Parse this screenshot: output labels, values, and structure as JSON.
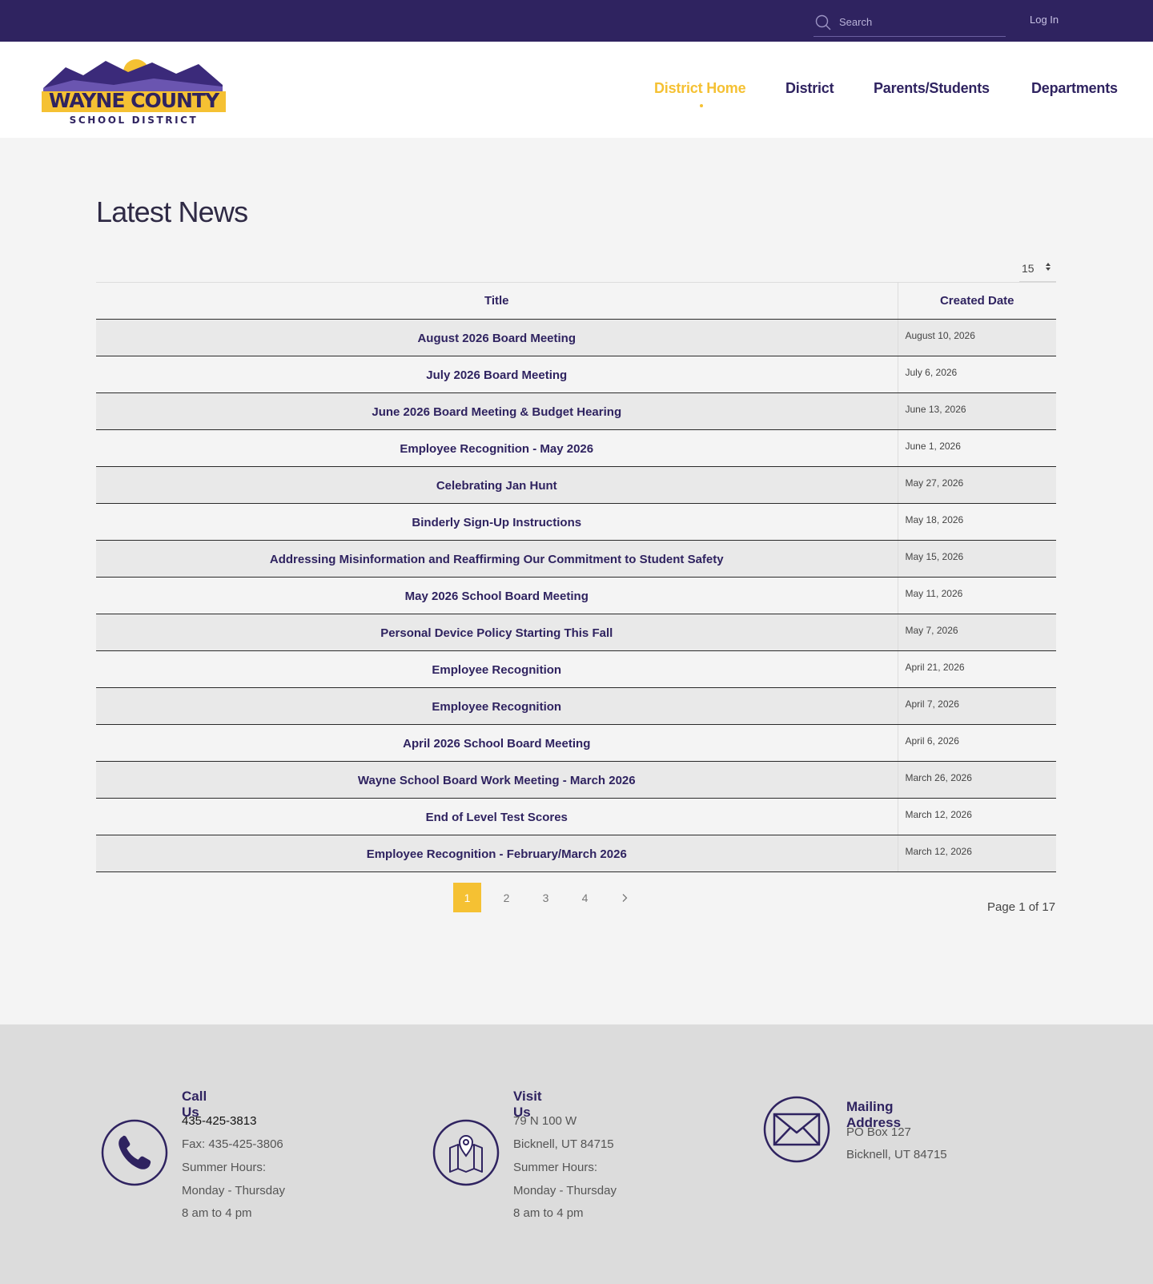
{
  "topbar": {
    "search_placeholder": "Search",
    "login_label": "Log In"
  },
  "logo": {
    "line1": "WAYNE COUNTY",
    "line2": "SCHOOL DISTRICT"
  },
  "nav": {
    "items": [
      {
        "label": "District Home",
        "active": true
      },
      {
        "label": "District",
        "active": false
      },
      {
        "label": "Parents/Students",
        "active": false
      },
      {
        "label": "Departments",
        "active": false
      }
    ]
  },
  "main": {
    "title": "Latest News",
    "per_page": "15",
    "columns": {
      "title": "Title",
      "created_date": "Created Date"
    },
    "rows": [
      {
        "title": "August 2026 Board Meeting",
        "date": "August 10, 2026"
      },
      {
        "title": "July 2026 Board Meeting",
        "date": "July 6, 2026"
      },
      {
        "title": "June 2026 Board Meeting & Budget Hearing",
        "date": "June 13, 2026"
      },
      {
        "title": "Employee Recognition - May 2026",
        "date": "June 1, 2026"
      },
      {
        "title": "Celebrating Jan Hunt",
        "date": "May 27, 2026"
      },
      {
        "title": "Binderly Sign-Up Instructions",
        "date": "May 18, 2026"
      },
      {
        "title": "Addressing Misinformation and Reaffirming Our Commitment to Student Safety",
        "date": "May 15, 2026"
      },
      {
        "title": "May 2026 School Board Meeting",
        "date": "May 11, 2026"
      },
      {
        "title": "Personal Device Policy Starting This Fall",
        "date": "May 7, 2026"
      },
      {
        "title": "Employee Recognition",
        "date": "April 21, 2026"
      },
      {
        "title": "Employee Recognition",
        "date": "April 7, 2026"
      },
      {
        "title": "April 2026 School Board Meeting",
        "date": "April 6, 2026"
      },
      {
        "title": "Wayne School Board Work Meeting - March 2026",
        "date": "March 26, 2026"
      },
      {
        "title": "End of Level Test Scores",
        "date": "March 12, 2026"
      },
      {
        "title": "Employee Recognition - February/March 2026",
        "date": "March 12, 2026"
      }
    ],
    "pagination": {
      "pages": [
        "1",
        "2",
        "3",
        "4"
      ],
      "current": "1",
      "status": "Page 1 of 17"
    }
  },
  "footer": {
    "call": {
      "heading": "Call Us",
      "phone": "435-425-3813",
      "fax": "Fax: 435-425-3806",
      "hours_label": "Summer Hours:",
      "days": "Monday - Thursday",
      "time": "8 am to 4 pm"
    },
    "visit": {
      "heading": "Visit Us",
      "street": "79 N 100 W",
      "city": "Bicknell, UT 84715",
      "hours_label": "Summer Hours:",
      "days": "Monday - Thursday",
      "time": "8 am to 4 pm"
    },
    "mail": {
      "heading": "Mailing Address",
      "box": "PO Box 127",
      "city": "Bicknell, UT 84715"
    }
  },
  "colors": {
    "brand_purple": "#2f2360",
    "accent_yellow": "#f5c133",
    "page_bg": "#f4f4f4",
    "footer_bg": "#dcdcdc"
  },
  "icons": [
    "search-icon",
    "sort-arrows-icon",
    "chevron-right-icon",
    "phone-icon",
    "map-pin-icon",
    "envelope-icon"
  ]
}
